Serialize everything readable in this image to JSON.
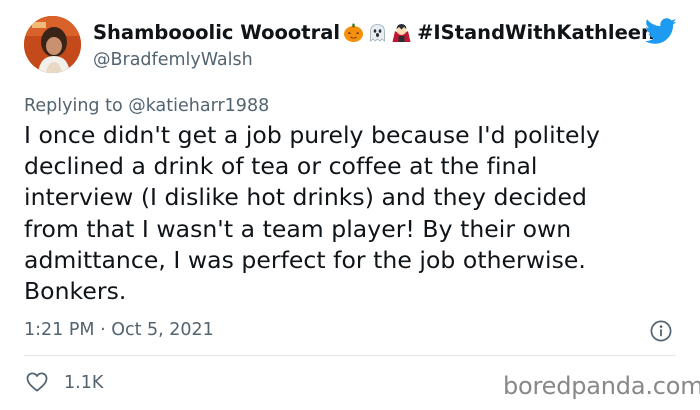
{
  "author": {
    "display_name": "Shambooolic Woootral",
    "emojis": [
      "jack-o-lantern-icon",
      "ghost-icon",
      "vampire-icon"
    ],
    "hashtag": "#IStandWithKathleen",
    "handle": "@BradfemlyWalsh"
  },
  "reply_context": {
    "prefix": "Replying to ",
    "mention": "@katieharr1988"
  },
  "tweet": {
    "text": "I once didn't get a job purely because I'd politely\ndeclined a drink of tea or coffee at the final\ninterview (I dislike hot drinks) and they decided\nfrom that I wasn't a team player! By their own\nadmittance, I was perfect for the job otherwise.\nBonkers.",
    "timestamp": "1:21 PM · Oct 5, 2021"
  },
  "engagement": {
    "likes": "1.1K"
  },
  "watermark": "boredpanda.com",
  "colors": {
    "twitter_blue": "#1d9bf0",
    "secondary_text": "#536471",
    "primary_text": "#0f1419"
  }
}
